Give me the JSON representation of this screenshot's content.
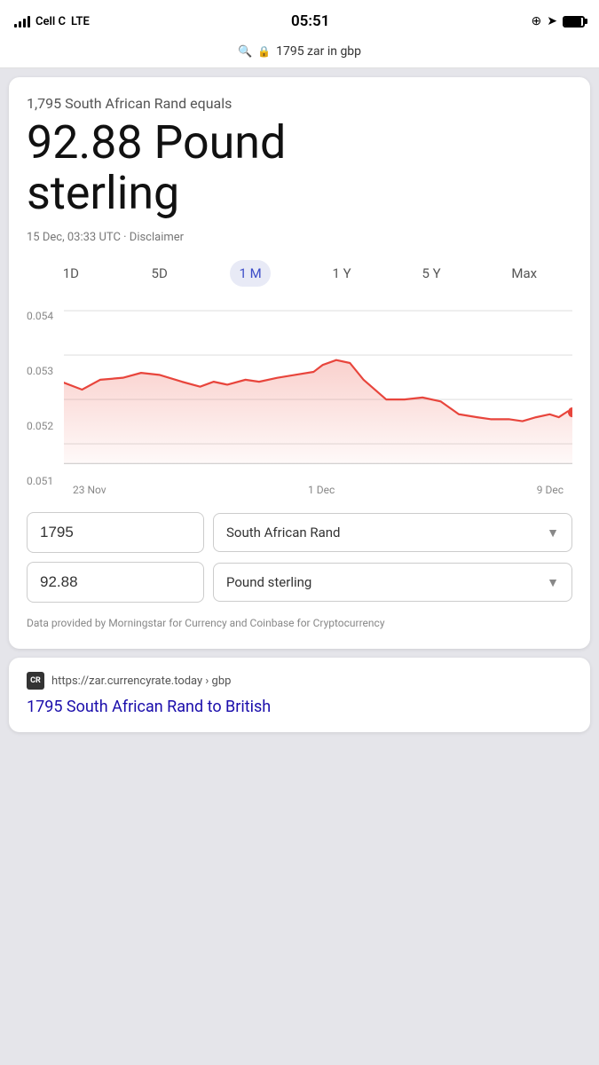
{
  "statusBar": {
    "carrier": "Cell C",
    "networkType": "LTE",
    "time": "05:51"
  },
  "searchBar": {
    "query": "1795 zar in gbp"
  },
  "conversion": {
    "subtitle": "1,795 South African Rand equals",
    "result": "92.88 Pound sterling",
    "result_line1": "92.88 Pound",
    "result_line2": "sterling",
    "timestamp": "15 Dec, 03:33 UTC",
    "disclaimer": "Disclaimer"
  },
  "timeTabs": [
    {
      "label": "1D",
      "active": false
    },
    {
      "label": "5D",
      "active": false
    },
    {
      "label": "1 M",
      "active": true
    },
    {
      "label": "1 Y",
      "active": false
    },
    {
      "label": "5 Y",
      "active": false
    },
    {
      "label": "Max",
      "active": false
    }
  ],
  "chart": {
    "yLabels": [
      "0.054",
      "0.053",
      "0.052",
      "0.051"
    ],
    "xLabels": [
      "23 Nov",
      "1 Dec",
      "9 Dec"
    ]
  },
  "converter": {
    "fromValue": "1795",
    "fromCurrency": "South African Rand",
    "toValue": "92.88",
    "toCurrency": "Pound sterling"
  },
  "dataSource": "Data provided by Morningstar for Currency and Coinbase for Cryptocurrency",
  "linkCard": {
    "faviconText": "CR",
    "url": "https://zar.currencyrate.today › gbp",
    "title": "1795 South African Rand to British"
  }
}
